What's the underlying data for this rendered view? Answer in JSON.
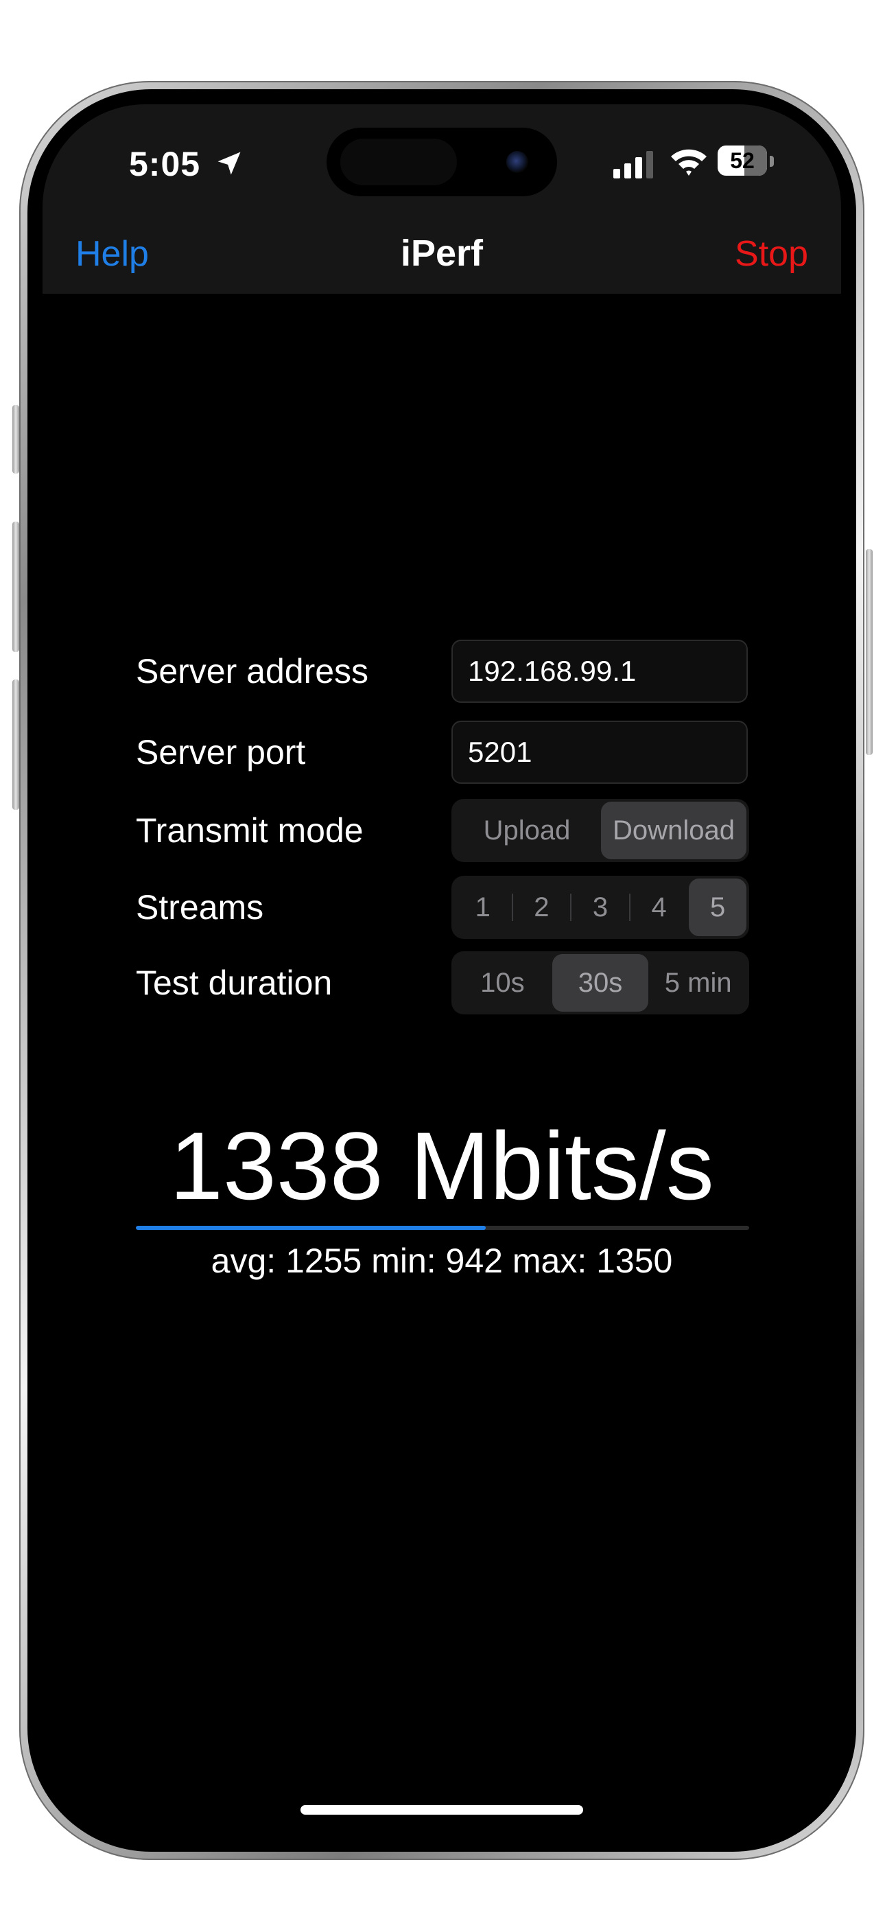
{
  "status_bar": {
    "time": "5:05",
    "battery_level": "52",
    "icons": [
      "location-arrow-icon",
      "signal-icon",
      "wifi-icon",
      "battery-icon"
    ]
  },
  "nav": {
    "left_label": "Help",
    "title": "iPerf",
    "right_label": "Stop",
    "colors": {
      "accent": "#1f7fe6",
      "destructive": "#e81818"
    }
  },
  "form": {
    "server_address": {
      "label": "Server address",
      "value": "192.168.99.1"
    },
    "server_port": {
      "label": "Server port",
      "value": "5201"
    },
    "transmit_mode": {
      "label": "Transmit mode",
      "options": [
        "Upload",
        "Download"
      ],
      "selected": "Download"
    },
    "streams": {
      "label": "Streams",
      "options": [
        "1",
        "2",
        "3",
        "4",
        "5"
      ],
      "selected": "5"
    },
    "test_duration": {
      "label": "Test duration",
      "options": [
        "10s",
        "30s",
        "5 min"
      ],
      "selected": "30s"
    }
  },
  "result": {
    "speed": "1338 Mbits/s",
    "stats": "avg: 1255 min: 942 max: 1350",
    "progress_fraction": 0.57
  }
}
